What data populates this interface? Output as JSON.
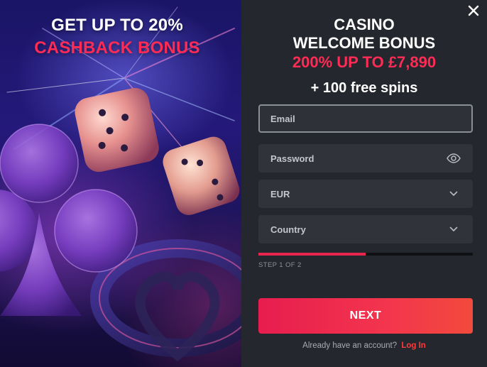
{
  "promo": {
    "line1": "GET UP TO 20%",
    "line2": "CASHBACK BONUS"
  },
  "offer": {
    "line1": "CASINO",
    "line2": "WELCOME BONUS",
    "amount": "200% UP TO £7,890",
    "spins": "+ 100 free spins"
  },
  "form": {
    "email_label": "Email",
    "password_label": "Password",
    "currency_value": "EUR",
    "country_label": "Country",
    "progress_fraction": 0.5,
    "step_text": "STEP 1 OF 2",
    "next_label": "NEXT"
  },
  "footer": {
    "question": "Already have an account?",
    "login_label": "Log In"
  },
  "icons": {
    "close": "close-icon",
    "password_visibility": "eye-icon",
    "dropdown": "chevron-down-icon"
  },
  "colors": {
    "accent_red": "#ff2b55",
    "panel_bg": "#25272e",
    "field_bg": "#31333b"
  }
}
